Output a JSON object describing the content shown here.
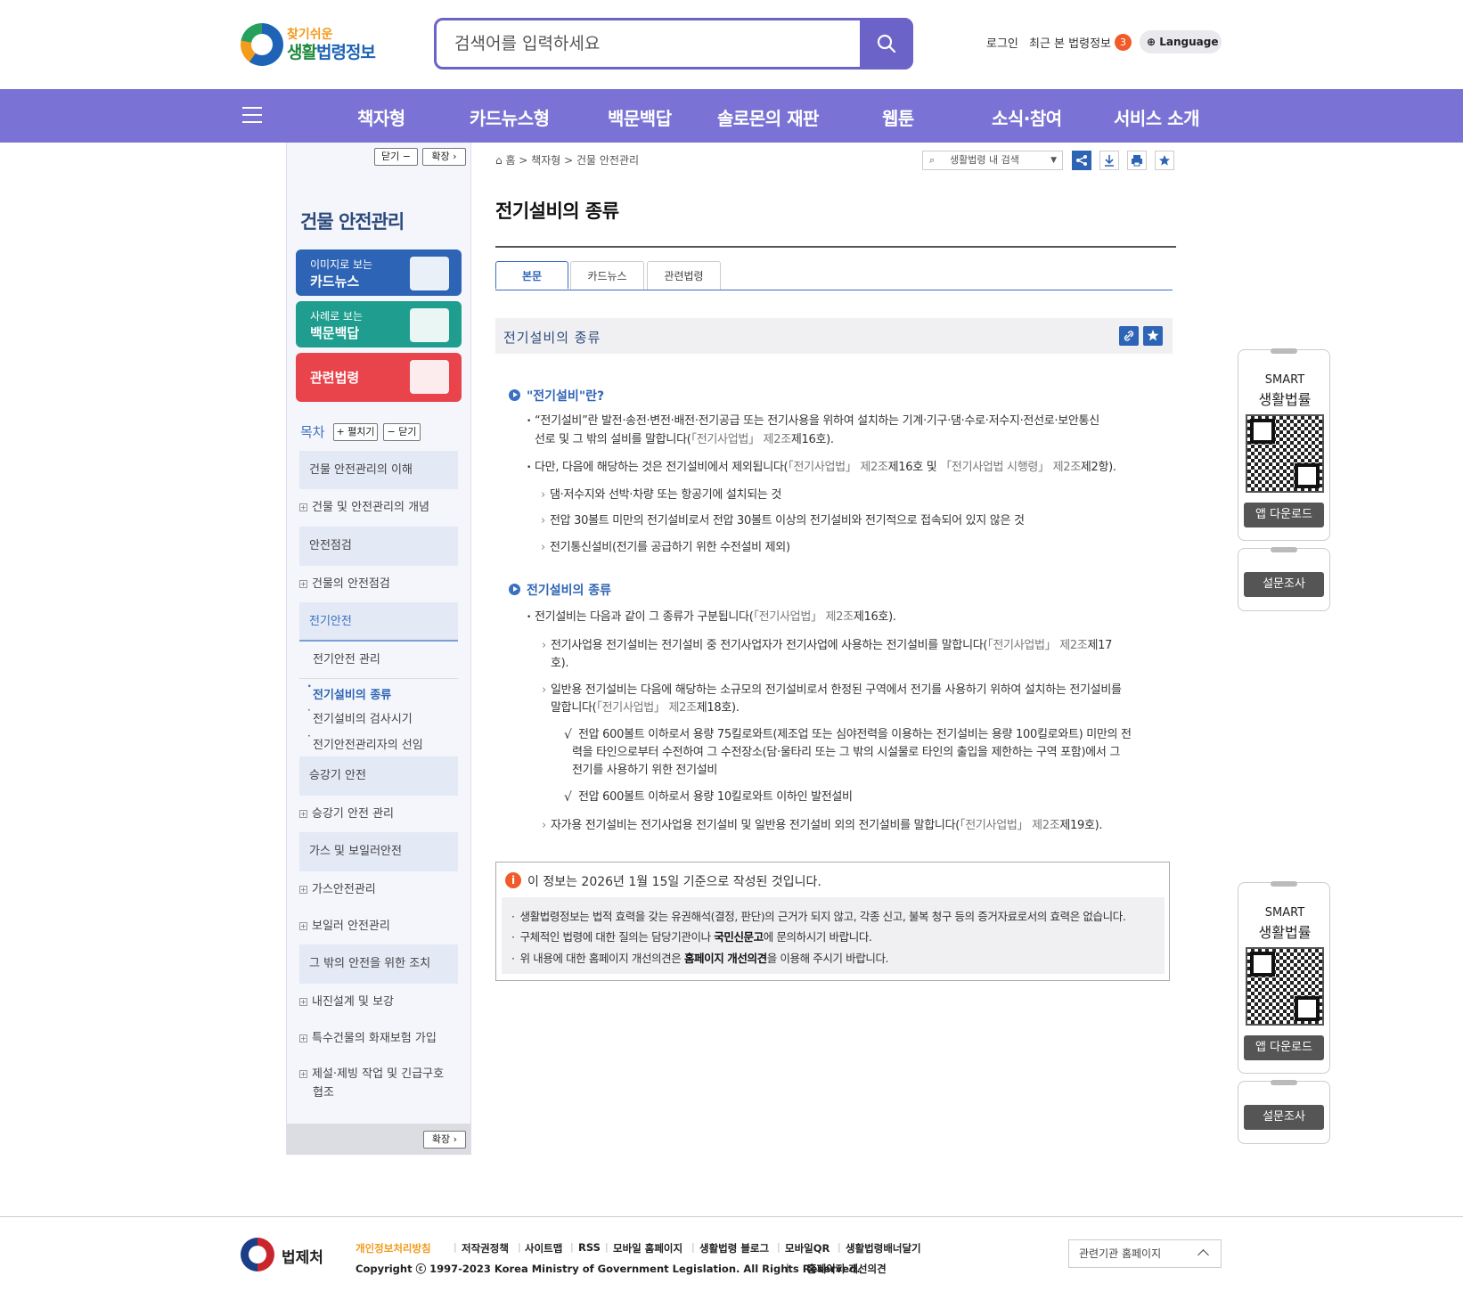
{
  "header": {
    "logo_top": "찾기쉬운",
    "logo_main_a": "생활",
    "logo_main_b": "법령정보",
    "search_placeholder": "검색어를 입력하세요",
    "login": "로그인",
    "recent": "최근 본 법령정보",
    "recent_count": "3",
    "language": "Language"
  },
  "nav": {
    "items": [
      "책자형",
      "카드뉴스형",
      "백문백답",
      "솔로몬의 재판",
      "웹툰",
      "소식·참여",
      "서비스 소개"
    ]
  },
  "sidebar": {
    "close_label": "닫기 −",
    "expand_label": "확장 ›",
    "title": "건물 안전관리",
    "cards": [
      {
        "sub": "이미지로 보는",
        "main": "카드뉴스",
        "color": "#2e64b5"
      },
      {
        "sub": "사례로 보는",
        "main": "백문백답",
        "color": "#1f9e8f"
      },
      {
        "sub": "",
        "main": "관련법령",
        "color": "#e9434b"
      }
    ],
    "toc_label": "목차",
    "toc_expand": "+ 펼치기",
    "toc_close": "− 닫기",
    "sections": [
      {
        "title": "건물 안전관리의 이해",
        "items": [
          "건물 및 안전관리의 개념"
        ]
      },
      {
        "title": "안전점검",
        "items": [
          "건물의 안전점검"
        ]
      },
      {
        "title": "전기안전",
        "items": [
          "전기안전 관리"
        ],
        "subs": [
          "전기설비의 종류",
          "전기설비의 검사시기",
          "전기안전관리자의 선임"
        ]
      },
      {
        "title": "승강기 안전",
        "items": [
          "승강기 안전 관리"
        ]
      },
      {
        "title": "가스 및 보일러안전",
        "items": [
          "가스안전관리",
          "보일러 안전관리"
        ]
      },
      {
        "title": "그 밖의 안전을 위한 조치",
        "items": [
          "내진설계 및 보강",
          "특수건물의 화재보험 가입",
          "제설·제빙 작업 및 긴급구호",
          "협조"
        ]
      }
    ],
    "footer_expand": "확장 ›"
  },
  "content": {
    "breadcrumb": "홈 > 책자형 > 건물 안전관리",
    "inner_search": "생활법령 내 검색",
    "page_title": "전기설비의 종류",
    "tabs": [
      "본문",
      "카드뉴스",
      "관련법령"
    ],
    "section_title": "전기설비의 종류",
    "h1": "\"전기설비\"란?",
    "p1a": "“전기설비”란 발전·송전·변전·배전·전기공급 또는 전기사용을 위하여 설치하는 기계·기구·댐·수로·저수지·전선로·보안통신",
    "p1b_pre": "선로 및 그 밖의 설비를 말합니다(",
    "p1b_law": "「전기사업법」 제2조",
    "p1b_post": "제16호).",
    "p2_pre": "다만, 다음에 해당하는 것은 전기설비에서 제외됩니다(",
    "p2_law1": "「전기사업법」 제2조",
    "p2_mid": "제16호 및 ",
    "p2_law2": "「전기사업법 시행령」 제2조",
    "p2_post": "제2항).",
    "a1": "댐·저수지와 선박·차량 또는 항공기에 설치되는 것",
    "a2": "전압 30볼트 미만의 전기설비로서 전압 30볼트 이상의 전기설비와 전기적으로 접속되어 있지 않은 것",
    "a3": "전기통신설비(전기를 공급하기 위한 수전설비 제외)",
    "h2": "전기설비의 종류",
    "p3_pre": "전기설비는 다음과 같이 그 종류가 구분됩니다(",
    "p3_law": "「전기사업법」 제2조",
    "p3_post": "제16호).",
    "b1a_pre": "전기사업용 전기설비는 전기설비 중 전기사업자가 전기사업에 사용하는 전기설비를 말합니다(",
    "b1a_law": "「전기사업법」 제2조",
    "b1a_post": "제17",
    "b1b": "호).",
    "b2a": "일반용 전기설비는 다음에 해당하는 소규모의 전기설비로서 한정된 구역에서 전기를 사용하기 위하여 설치하는 전기설비를",
    "b2b_pre": "말합니다(",
    "b2b_law": "「전기사업법」 제2조",
    "b2b_post": "제18호).",
    "c1a": "전압 600볼트 이하로서 용량 75킬로와트(제조업 또는 심야전력을 이용하는 전기설비는 용량 100킬로와트) 미만의 전",
    "c1b": "력을 타인으로부터 수전하여 그 수전장소(담·울타리 또는 그 밖의 시설물로 타인의 출입을 제한하는 구역 포함)에서 그",
    "c1c": "전기를 사용하기 위한 전기설비",
    "c2": "전압 600볼트 이하로서 용량 10킬로와트 이하인 발전설비",
    "b3_pre": "자가용 전기설비는 전기사업용 전기설비 및 일반용 전기설비 외의 전기설비를 말합니다(",
    "b3_law": "「전기사업법」 제2조",
    "b3_post": "제19호)."
  },
  "info": {
    "title": "이 정보는 2026년 1월 15일 기준으로 작성된 것입니다.",
    "l1": "생활법령정보는 법적 효력을 갖는 유권해석(결정, 판단)의 근거가 되지 않고, 각종 신고, 불복 청구 등의 증거자료로서의 효력은 없습니다.",
    "l2_pre": "구체적인 법령에 대한 질의는 담당기관이나 ",
    "l2_bold": "국민신문고",
    "l2_post": "에 문의하시기 바랍니다.",
    "l3_pre": "위 내용에 대한 홈페이지 개선의견은 ",
    "l3_bold": "홈페이지 개선의견",
    "l3_post": "을 이용해 주시기 바랍니다."
  },
  "widget": {
    "smart": "SMART",
    "app_name": "생활법률",
    "download": "앱 다운로드",
    "survey": "설문조사"
  },
  "footer": {
    "org": "법제처",
    "links": [
      "개인정보처리방침",
      "저작권정책",
      "사이트맵",
      "RSS",
      "모바일 홈페이지",
      "생활법령 블로그",
      "모바일QR",
      "생활법령배너달기"
    ],
    "copyright": "Copyright ⓒ 1997-2023 Korea Ministry of Government Legislation. All Rights Reserved.",
    "sep": "|",
    "improve": "홈페이지 개선의견",
    "related": "관련기관 홈페이지"
  },
  "colors": {
    "accent": "#7a72d4",
    "link": "#2e64b5",
    "alert": "#f15a29"
  }
}
